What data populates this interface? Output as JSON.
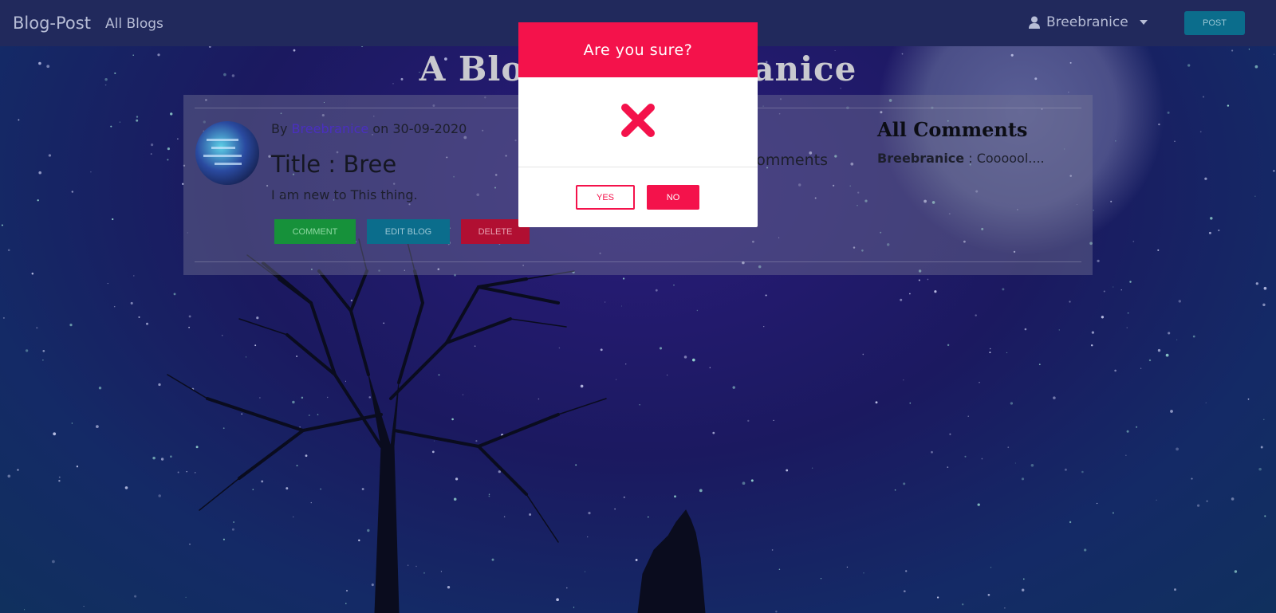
{
  "navbar": {
    "brand": "Blog-Post",
    "all_blogs_link": "All Blogs",
    "user_name": "Breebranice",
    "post_button": "POST"
  },
  "page": {
    "heading": "A Blog by Breebranice"
  },
  "blog": {
    "by_prefix": "By",
    "author": "Breebranice",
    "date_prefix": "on",
    "date": "30-09-2020",
    "title": "Title : Bree",
    "body": "I am new to This thing.",
    "comment_button": "COMMENT",
    "edit_button": "EDIT BLOG",
    "delete_button": "DELETE",
    "comments_count_label": "Comments"
  },
  "comments": {
    "heading": "All Comments",
    "items": [
      {
        "author": "Breebranice",
        "separator": " : ",
        "text": "Coooool...."
      }
    ]
  },
  "modal": {
    "title": "Are you sure?",
    "icon": "close-icon",
    "yes_label": "YES",
    "no_label": "NO"
  },
  "colors": {
    "navbar": "#21295c",
    "modal_accent": "#f4124b",
    "comment_btn": "#16913a",
    "edit_btn": "#0b6d8c",
    "delete_btn": "#b10f32"
  }
}
